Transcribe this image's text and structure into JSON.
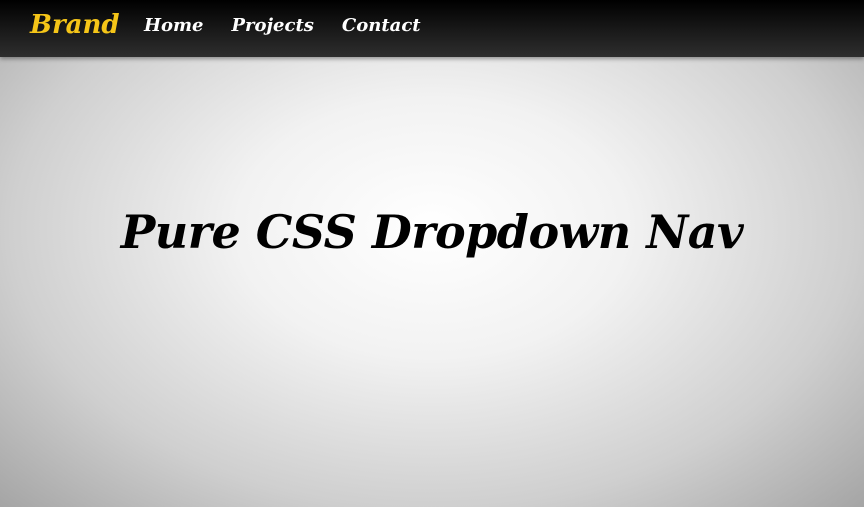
{
  "navbar": {
    "brand": "Brand",
    "links": [
      {
        "label": "Home"
      },
      {
        "label": "Projects"
      },
      {
        "label": "Contact"
      }
    ]
  },
  "main": {
    "title": "Pure CSS Dropdown Nav"
  },
  "colors": {
    "brand": "#f5c518",
    "nav_background": "#000000",
    "nav_text": "#ffffff",
    "title": "#000000"
  }
}
